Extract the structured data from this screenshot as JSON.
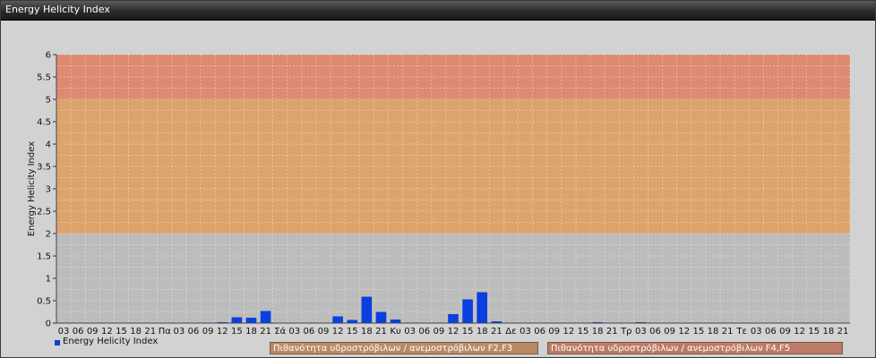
{
  "window": {
    "title": "Energy Helicity Index"
  },
  "colors": {
    "background": "#d2d2d2",
    "plot_bg": "#c2c2c2",
    "band_low": "#bcbcbc",
    "band_mid": "#dca46c",
    "band_high": "#de8a72",
    "bar": "#0a3fe0",
    "label_band_1": "#b98a66",
    "label_band_2": "#bd7a66"
  },
  "bands": {
    "f2f3_label": "Πιθανότητα υδροστρόβιλων / ανεμοστρόβιλων F2,F3",
    "f4f5_label": "Πιθανότητα υδροστρόβιλων / ανεμοστρόβιλων F4,F5",
    "ranges": [
      {
        "from": 0,
        "to": 2,
        "color": "#bcbcbc"
      },
      {
        "from": 2,
        "to": 5,
        "color": "#dca46c"
      },
      {
        "from": 5,
        "to": 6,
        "color": "#de8a72"
      }
    ]
  },
  "legend": {
    "series_label": "Energy Helicity Index",
    "icon": "square-marker"
  },
  "chart_data": {
    "type": "bar",
    "ylabel": "Energy Helicity Index",
    "xlabel": "",
    "ylim": [
      0,
      6
    ],
    "yticks": [
      "0",
      "0.5",
      "1",
      "1.5",
      "2",
      "2.5",
      "3",
      "3.5",
      "4",
      "4.5",
      "5",
      "5.5",
      "6"
    ],
    "grid": true,
    "legend_position": "bottom-left",
    "categories": [
      "03",
      "06",
      "09",
      "12",
      "15",
      "18",
      "21",
      "Πα",
      "03",
      "06",
      "09",
      "12",
      "15",
      "18",
      "21",
      "Σά",
      "03",
      "06",
      "09",
      "12",
      "15",
      "18",
      "21",
      "Κυ",
      "03",
      "06",
      "09",
      "12",
      "15",
      "18",
      "21",
      "Δε",
      "03",
      "06",
      "09",
      "12",
      "15",
      "18",
      "21",
      "Τρ",
      "03",
      "06",
      "09",
      "12",
      "15",
      "18",
      "21",
      "Τε",
      "03",
      "06",
      "09",
      "12",
      "15",
      "18",
      "21"
    ],
    "series": [
      {
        "name": "Energy Helicity Index",
        "values": [
          0.01,
          0.01,
          0.01,
          0.01,
          0.01,
          0.01,
          0.01,
          0.01,
          0.01,
          0.01,
          0.01,
          0.02,
          0.13,
          0.12,
          0.27,
          0.01,
          0.01,
          0.01,
          0.01,
          0.15,
          0.07,
          0.59,
          0.25,
          0.08,
          0.01,
          0.01,
          0.01,
          0.2,
          0.53,
          0.69,
          0.04,
          0.01,
          0.01,
          0.01,
          0.01,
          0.01,
          0.01,
          0.02,
          0.01,
          0.01,
          0.02,
          0.01,
          0.01,
          0.01,
          0.01,
          0.01,
          0.01,
          0.01,
          0.01,
          0.01,
          0.01,
          0.01,
          0.01,
          0.01,
          0.01
        ]
      }
    ]
  }
}
